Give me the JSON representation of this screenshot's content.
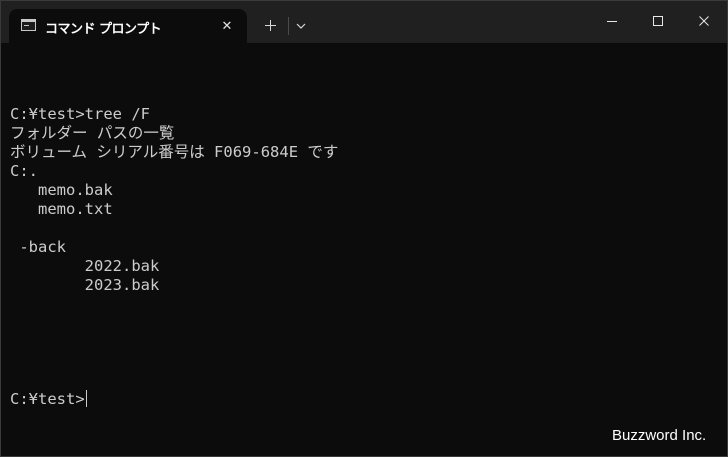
{
  "tab": {
    "title": "コマンド プロンプト",
    "icon": "command-prompt-icon",
    "close_glyph": "✕"
  },
  "titlebar": {
    "new_tab_icon": "plus-icon",
    "dropdown_icon": "chevron-down-icon",
    "minimize_icon": "minimize-icon",
    "maximize_icon": "maximize-icon",
    "close_icon": "close-icon"
  },
  "terminal": {
    "lines": [
      "C:¥test>tree /F",
      "フォルダー パスの一覧",
      "ボリューム シリアル番号は F069-684E です",
      "C:.",
      "   memo.bak",
      "   memo.txt",
      "",
      " -back",
      "        2022.bak",
      "        2023.bak",
      "",
      "",
      ""
    ],
    "prompt": "C:¥test>"
  },
  "watermark": "Buzzword Inc.",
  "colors": {
    "background": "#0c0c0c",
    "titlebar": "#202020",
    "text": "#cccccc"
  }
}
